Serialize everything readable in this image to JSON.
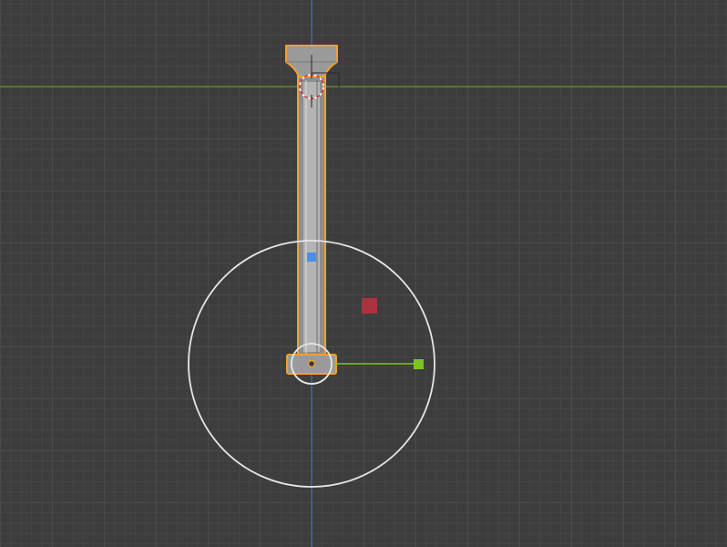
{
  "viewport": {
    "background": "#3d3d3d",
    "grid_color": "#4a4a4a",
    "axis_x_color": "#6b8f2a",
    "axis_y_color": "#3d6fb5"
  },
  "object": {
    "outline_color": "#f0a030",
    "body_color": "#9a9a9a",
    "highlight_color": "#c8c8c8"
  },
  "gizmo": {
    "circle_color": "#e6e6e6",
    "handle_blue": "#4a8ff0",
    "handle_red": "#c03040",
    "handle_green": "#7ac520",
    "origin_color": "#f0a030"
  },
  "icons": {
    "cursor": "3d-cursor-icon",
    "origin": "object-origin-icon"
  }
}
